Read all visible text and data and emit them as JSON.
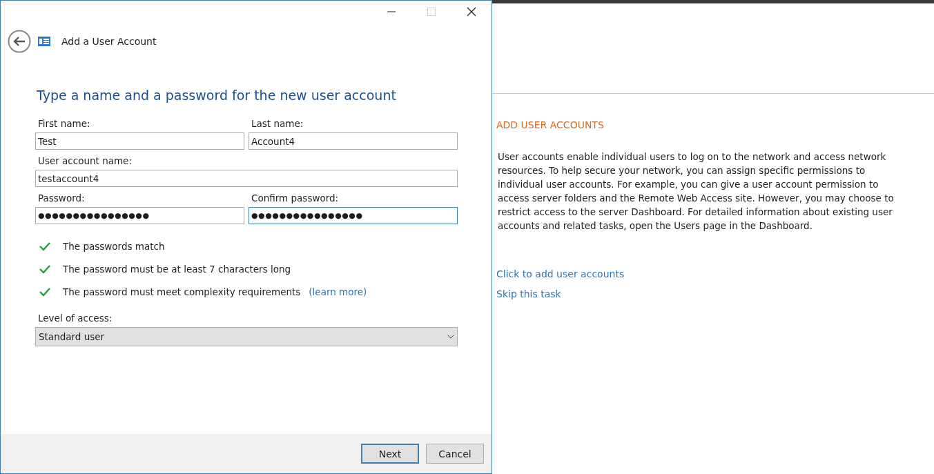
{
  "window": {
    "title": "Add a User Account",
    "maximize_disabled": true
  },
  "heading": "Type a name and a password for the new user account",
  "field_rows": [
    [
      {
        "label": "First name:",
        "value": "Test",
        "kind": "text",
        "focused": false
      },
      {
        "label": "Last name:",
        "value": "Account4",
        "kind": "text",
        "focused": false
      }
    ],
    [
      {
        "label": "User account name:",
        "value": "testaccount4",
        "kind": "text",
        "focused": false
      }
    ],
    [
      {
        "label": "Password:",
        "value": "●●●●●●●●●●●●●●●●",
        "kind": "password",
        "focused": false
      },
      {
        "label": "Confirm password:",
        "value": "●●●●●●●●●●●●●●●●",
        "kind": "password",
        "focused": true
      }
    ]
  ],
  "checks": [
    {
      "text": "The passwords match",
      "checked": true
    },
    {
      "text": "The password must be at least 7 characters long",
      "checked": true
    },
    {
      "text": "The password must meet complexity requirements",
      "checked": true,
      "link": "(learn more)"
    }
  ],
  "access": {
    "label": "Level of access:",
    "value": "Standard user"
  },
  "buttons": [
    {
      "label": "Next",
      "default": true
    },
    {
      "label": "Cancel",
      "default": false
    }
  ],
  "side_panel": {
    "title": "ADD USER ACCOUNTS",
    "body": "User accounts enable individual users to log on to the network and access network resources. To help secure your network, you can assign specific permissions to individual user accounts. For example, you can give a user account permission to access server folders and the Remote Web Access site. However, you may choose to restrict access to the server Dashboard. For detailed information about existing user accounts and related tasks, open the Users page in the Dashboard.",
    "links": [
      "Click to add user accounts",
      "Skip this task"
    ]
  }
}
